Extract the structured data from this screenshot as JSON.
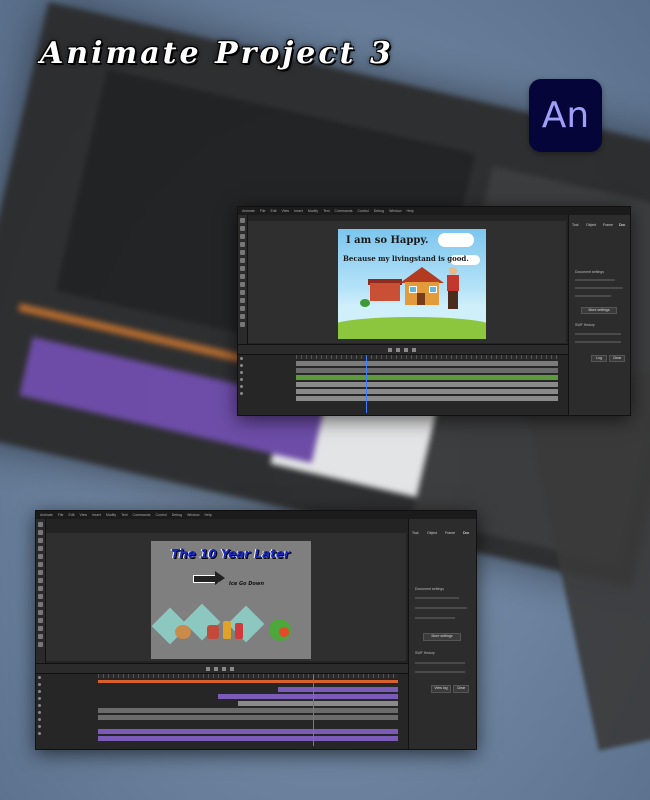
{
  "title": "Animate Project 3",
  "logo": {
    "text": "An",
    "bg": "#05053a",
    "fg": "#9f9ff8"
  },
  "window1": {
    "menu": [
      "Animate",
      "File",
      "Edit",
      "View",
      "Insert",
      "Modify",
      "Text",
      "Commands",
      "Control",
      "Debug",
      "Window",
      "Help"
    ],
    "scene_line1": "I am so Happy.",
    "scene_line2": "Because my livingstand is good.",
    "properties_tabs": [
      "Tool",
      "Object",
      "Frame",
      "Doc"
    ],
    "properties_sections": [
      "Document settings",
      "SWF History"
    ],
    "more_settings": "More settings",
    "log_btn": "Log",
    "clear_btn": "Clear"
  },
  "window2": {
    "menu": [
      "Animate",
      "File",
      "Edit",
      "View",
      "Insert",
      "Modify",
      "Text",
      "Commands",
      "Control",
      "Debug",
      "Window",
      "Help"
    ],
    "headline": "The 10 Year Later",
    "sub": "Ice Go Down",
    "properties_tabs": [
      "Tool",
      "Object",
      "Frame",
      "Doc"
    ],
    "properties_sections": [
      "Document settings",
      "SWF History"
    ],
    "more_settings": "More settings",
    "log_btn": "View log",
    "clear_btn": "Clear"
  },
  "colors": {
    "accent": "#3d7eff",
    "timeline_purple": "#7a5bb8",
    "timeline_green": "#5c9a3c",
    "timeline_orange": "#d9602a"
  }
}
